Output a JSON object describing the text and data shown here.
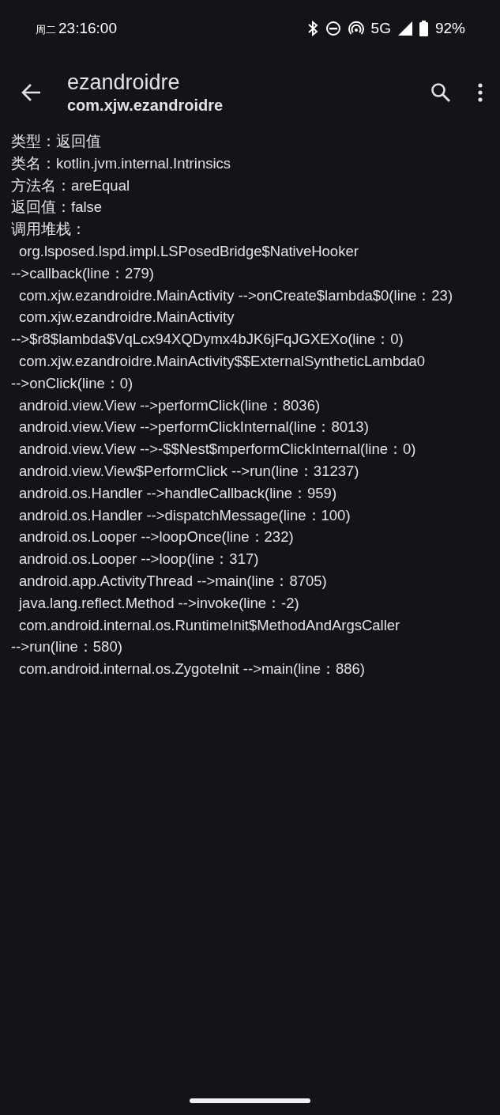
{
  "status_bar": {
    "day": "周二",
    "time": "23:16:00",
    "network": "5G",
    "battery": "92%"
  },
  "app_bar": {
    "title": "ezandroidre",
    "subtitle": "com.xjw.ezandroidre"
  },
  "fields": [
    {
      "label": "类型：",
      "value": "返回值"
    },
    {
      "label": "类名：",
      "value": "kotlin.jvm.internal.Intrinsics"
    },
    {
      "label": "方法名：",
      "value": "areEqual"
    },
    {
      "label": "返回值：",
      "value": "false"
    },
    {
      "label": "调用堆栈："
    }
  ],
  "stack_lines": [
    {
      "kind": "entry",
      "text": "org.lsposed.lspd.impl.LSPosedBridge$NativeHooker"
    },
    {
      "kind": "continuation",
      "text": "-->callback(line：279)"
    },
    {
      "kind": "entry",
      "text": "com.xjw.ezandroidre.MainActivity -->onCreate$lambda$0(line：23)"
    },
    {
      "kind": "entry",
      "text": "com.xjw.ezandroidre.MainActivity"
    },
    {
      "kind": "continuation",
      "text": "-->$r8$lambda$VqLcx94XQDymx4bJK6jFqJGXEXo(line：0)"
    },
    {
      "kind": "entry",
      "text": "com.xjw.ezandroidre.MainActivity$$ExternalSyntheticLambda0"
    },
    {
      "kind": "continuation",
      "text": "-->onClick(line：0)"
    },
    {
      "kind": "entry",
      "text": "android.view.View -->performClick(line：8036)"
    },
    {
      "kind": "entry",
      "text": "android.view.View -->performClickInternal(line：8013)"
    },
    {
      "kind": "entry",
      "text": "android.view.View -->-$$Nest$mperformClickInternal(line：0)"
    },
    {
      "kind": "entry",
      "text": "android.view.View$PerformClick -->run(line：31237)"
    },
    {
      "kind": "entry",
      "text": "android.os.Handler -->handleCallback(line：959)"
    },
    {
      "kind": "entry",
      "text": "android.os.Handler -->dispatchMessage(line：100)"
    },
    {
      "kind": "entry",
      "text": "android.os.Looper -->loopOnce(line：232)"
    },
    {
      "kind": "entry",
      "text": "android.os.Looper -->loop(line：317)"
    },
    {
      "kind": "entry",
      "text": "android.app.ActivityThread -->main(line：8705)"
    },
    {
      "kind": "entry",
      "text": "java.lang.reflect.Method -->invoke(line：-2)"
    },
    {
      "kind": "entry",
      "text": "com.android.internal.os.RuntimeInit$MethodAndArgsCaller"
    },
    {
      "kind": "continuation",
      "text": "-->run(line：580)"
    },
    {
      "kind": "entry",
      "text": "com.android.internal.os.ZygoteInit -->main(line：886)"
    }
  ]
}
